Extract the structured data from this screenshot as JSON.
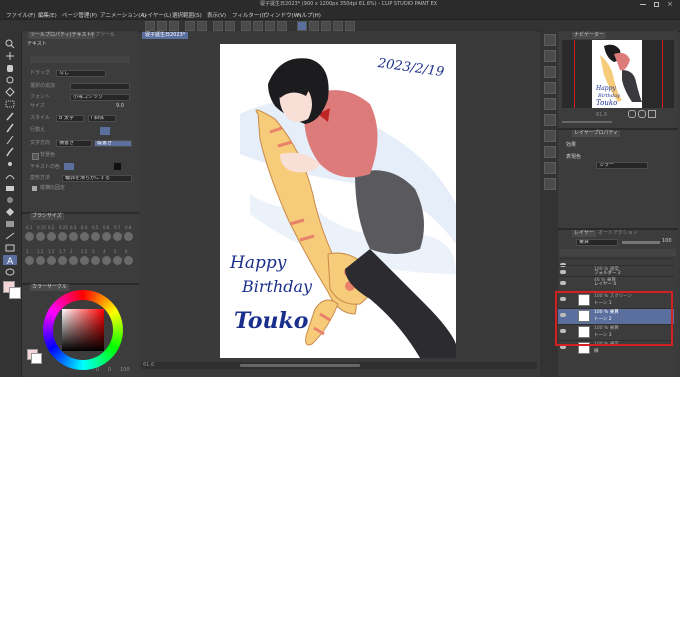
{
  "window": {
    "title": "寝子誕生日2023* (900 x 1200px 350dpi 61.6%) - CLIP STUDIO PAINT EX"
  },
  "menubar": [
    "ファイル(F)",
    "編集(E)",
    "ページ管理(P)",
    "アニメーション(A)",
    "レイヤー(L)",
    "選択範囲(S)",
    "表示(V)",
    "フィルター(I)",
    "ウィンドウ(W)",
    "ヘルプ(H)"
  ],
  "left_panel": {
    "tabs": [
      "ツールプロパティ(テキスト)",
      "サブツール"
    ],
    "title": "テキスト",
    "rows": {
      "drag_label": "ドラッグ",
      "drag_value": "なし",
      "fill_label": "選択の追加",
      "font_label": "フォント",
      "font_value": "小塚ゴシック",
      "size_label": "サイズ",
      "size_value": "9.0",
      "style_label": "スタイル",
      "bold": "B 太字",
      "italic": "I 斜体",
      "align_label": "行揃え",
      "direction_label": "文字方向",
      "horizontal": "横書き",
      "vertical": "縦書き",
      "text_color_label": "文字色",
      "background_label": "背景色",
      "text_color2_label": "テキストの色",
      "antialias_label": "変形方法",
      "antialias_value": "輪郭を滑らかにする",
      "fixed_label": "縦横比固定"
    },
    "brush_size_tab": "ブラシサイズ",
    "brush_sizes": [
      "0.1",
      "0.15",
      "0.2",
      "0.25",
      "0.3",
      "0.4",
      "0.5",
      "0.6",
      "0.7",
      "0.8",
      "1",
      "1.2",
      "1.5",
      "1.7",
      "2",
      "2.5",
      "3",
      "4",
      "5",
      "6"
    ],
    "color_tab": "カラーサークル",
    "status": {
      "h": "0",
      "s": "0",
      "v": "100"
    }
  },
  "canvas": {
    "tab": "寝子誕生日2023*",
    "date_text": "2023/2/19",
    "greeting_line1": "Happy",
    "greeting_line2": "Birthday",
    "greeting_line3": "Touko",
    "zoom": "61.6"
  },
  "right_panel": {
    "navigator_tab": "ナビゲーター",
    "nav_zoom": "61.6",
    "layer_property_tab": "レイヤープロパティ",
    "effect_label": "効果",
    "expression_label": "表現色",
    "expression_value": "カラー",
    "layer_tabs": [
      "レイヤー",
      "オートアクション"
    ],
    "blend_mode": "乗算",
    "opacity": "100",
    "layers": [
      {
        "pct": "",
        "name": "",
        "selected": false
      },
      {
        "pct": "100 % 通常",
        "name": "フォルダー 2",
        "selected": false
      },
      {
        "pct": "46 % 乗算",
        "name": "レイヤー 4",
        "selected": false
      },
      {
        "pct": "100 % スクリーン",
        "name": "トーン 1",
        "selected": false
      },
      {
        "pct": "100 % 乗算",
        "name": "トーン 2",
        "selected": true
      },
      {
        "pct": "100 % 乗算",
        "name": "トーン 3",
        "selected": false
      },
      {
        "pct": "100 % 通常",
        "name": "線",
        "selected": false
      }
    ]
  },
  "colors": {
    "app_bg": "#3a3a3a",
    "menubar_bg": "#2b2b2b",
    "panel_bg": "#3c3c3c",
    "accent_blue": "#5b6f9e",
    "highlight_red": "#d32020",
    "ink_blue": "#1a2f8c",
    "skin": "#f9e0d6",
    "shirt_pink": "#dd7b7b",
    "skirt_gray": "#5a5a5e",
    "cat_yellow": "#f6cb7a",
    "cat_stripe": "#e8826a",
    "hair": "#1c1c1e"
  }
}
